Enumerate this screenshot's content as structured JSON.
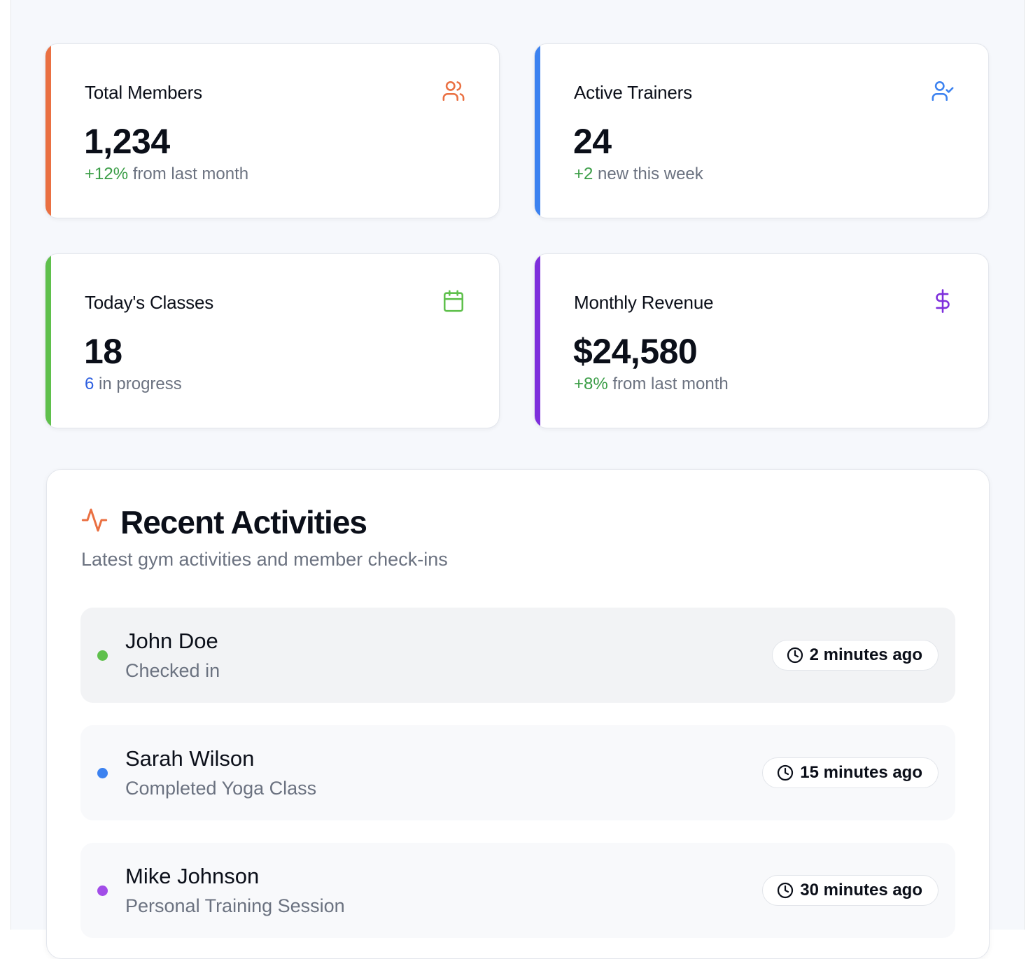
{
  "stats": [
    {
      "title": "Total Members",
      "value": "1,234",
      "highlight": "+12%",
      "rest": " from last month",
      "accent": "#ea7042",
      "highlight_color": "#3a9d46",
      "icon": "users-icon"
    },
    {
      "title": "Active Trainers",
      "value": "24",
      "highlight": "+2",
      "rest": " new this week",
      "accent": "#3c82f0",
      "highlight_color": "#3a9d46",
      "icon": "user-check-icon"
    },
    {
      "title": "Today's Classes",
      "value": "18",
      "highlight": "6",
      "rest": " in progress",
      "accent": "#5fc04c",
      "highlight_color": "#2d5fe0",
      "icon": "calendar-icon"
    },
    {
      "title": "Monthly Revenue",
      "value": "$24,580",
      "highlight": "+8%",
      "rest": " from last month",
      "accent": "#7e2fdc",
      "highlight_color": "#3a9d46",
      "icon": "dollar-icon"
    }
  ],
  "activities": {
    "title": "Recent Activities",
    "subtitle": "Latest gym activities and member check-ins",
    "icon": "activity-icon",
    "items": [
      {
        "name": "John Doe",
        "action": "Checked in",
        "time": "2 minutes ago",
        "dot": "#5fc04c"
      },
      {
        "name": "Sarah Wilson",
        "action": "Completed Yoga Class",
        "time": "15 minutes ago",
        "dot": "#3c82f0"
      },
      {
        "name": "Mike Johnson",
        "action": "Personal Training Session",
        "time": "30 minutes ago",
        "dot": "#a24de8"
      }
    ]
  }
}
